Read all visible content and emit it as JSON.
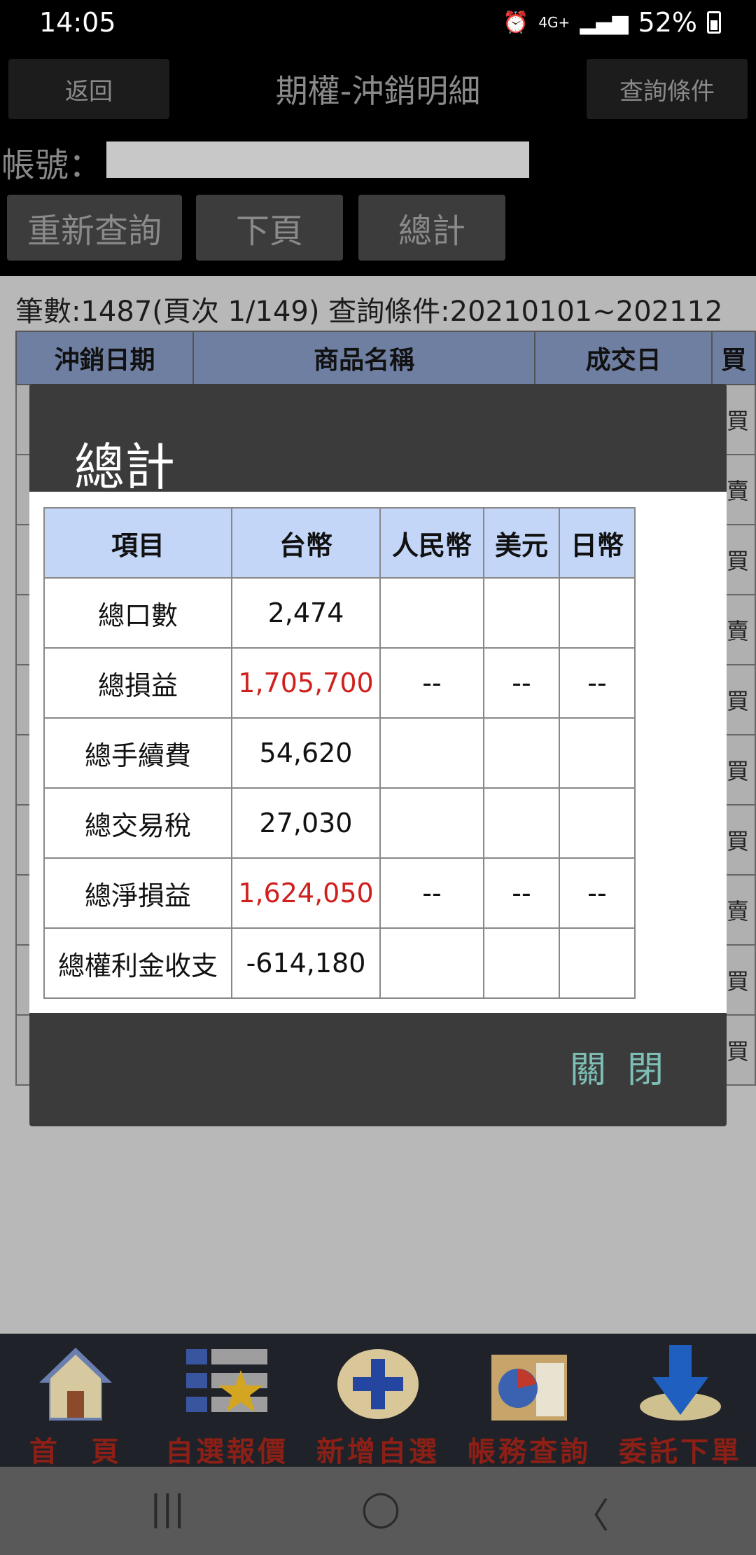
{
  "status_bar": {
    "time": "14:05",
    "network": "4G+",
    "battery": "52%"
  },
  "header": {
    "back_label": "返回",
    "title": "期權-沖銷明細",
    "query_label": "查詢條件"
  },
  "account": {
    "label": "帳號："
  },
  "actions": {
    "requery": "重新查詢",
    "next_page": "下頁",
    "total": "總計"
  },
  "info": {
    "summary": "筆數:1487(頁次 1/149) 查詢條件:20210101~202112"
  },
  "background_table": {
    "headers": [
      "沖銷日期",
      "商品名稱",
      "成交日",
      "買"
    ],
    "right_col": [
      "買",
      "賣",
      "買",
      "賣",
      "買",
      "買",
      "買",
      "賣",
      "買",
      "買"
    ]
  },
  "modal": {
    "title": "總計",
    "headers": [
      "項目",
      "台幣",
      "人民幣",
      "美元",
      "日幣"
    ],
    "rows": [
      {
        "item": "總口數",
        "twd": "2,474",
        "cny": "",
        "usd": "",
        "jpy": ""
      },
      {
        "item": "總損益",
        "twd": "1,705,700",
        "cny": "--",
        "usd": "--",
        "jpy": "--"
      },
      {
        "item": "總手續費",
        "twd": "54,620",
        "cny": "",
        "usd": "",
        "jpy": ""
      },
      {
        "item": "總交易稅",
        "twd": "27,030",
        "cny": "",
        "usd": "",
        "jpy": ""
      },
      {
        "item": "總淨損益",
        "twd": "1,624,050",
        "cny": "--",
        "usd": "--",
        "jpy": "--"
      },
      {
        "item": "總權利金收支",
        "twd": "-614,180",
        "cny": "",
        "usd": "",
        "jpy": ""
      }
    ],
    "close_label": "關閉",
    "highlight_color": "#d0201e"
  },
  "bottom_nav": {
    "items": [
      {
        "label": "首　頁",
        "icon": "home-icon"
      },
      {
        "label": "自選報價",
        "icon": "watchlist-star-icon"
      },
      {
        "label": "新增自選",
        "icon": "add-plus-icon"
      },
      {
        "label": "帳務查詢",
        "icon": "account-folder-icon"
      },
      {
        "label": "委託下單",
        "icon": "order-down-arrow-icon"
      }
    ]
  }
}
